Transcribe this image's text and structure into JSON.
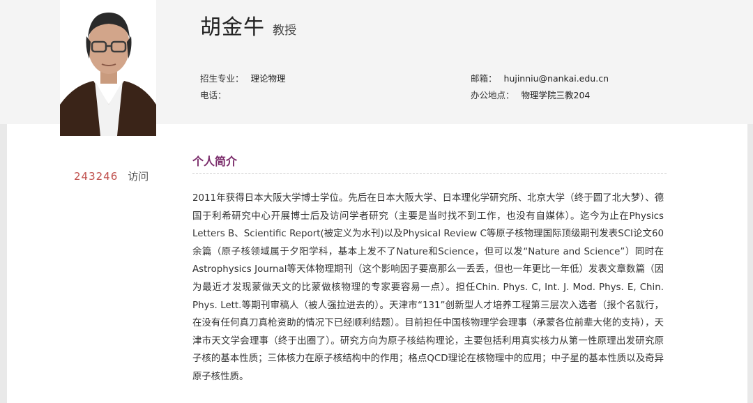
{
  "profile": {
    "name": "胡金牛",
    "title": "教授",
    "photo_alt": "person-portrait"
  },
  "info": {
    "major_label": "招生专业：",
    "major_value": "理论物理",
    "phone_label": "电话：",
    "phone_value": "",
    "email_label": "邮箱：",
    "email_value": "hujinniu@nankai.edu.cn",
    "office_label": "办公地点：",
    "office_value": "物理学院三教204"
  },
  "visits": {
    "count": "243246",
    "unit": "访问"
  },
  "section": {
    "heading": "个人简介"
  },
  "bio": "2011年获得日本大阪大学博士学位。先后在日本大阪大学、日本理化学研究所、北京大学（终于圆了北大梦）、德国于利希研究中心开展博士后及访问学者研究（主要是当时找不到工作，也没有自媒体）。迄今为止在Physics Letters B、Scientific Report(被定义为水刊)以及Physical Review C等原子核物理国际顶级期刊发表SCI论文60余篇（原子核领域属于夕阳学科，基本上发不了Nature和Science，但可以发“Nature and Science”）同时在Astrophysics Journal等天体物理期刊（这个影响因子要高那么一丢丢，但也一年更比一年低）发表文章数篇（因为最近才发现蒙做天文的比蒙做核物理的专家要容易一点）。担任Chin. Phys. C, Int. J. Mod. Phys. E, Chin. Phys. Lett.等期刊审稿人（被人强拉进去的）。天津市“131”创新型人才培养工程第三层次入选者（报个名就行，在没有任何真刀真枪资助的情况下已经顺利结题）。目前担任中国核物理学会理事（承蒙各位前辈大佬的支持），天津市天文学会理事（终于出圈了）。研究方向为原子核结构理论，主要包括利用真实核力从第一性原理出发研究原子核的基本性质；三体核力在原子核结构中的作用；格点QCD理论在核物理中的应用；中子星的基本性质以及奇异原子核性质。",
  "colors": {
    "visit_count": "#c0504d",
    "heading": "#7a2b6a",
    "header_bg": "#f4f4f4",
    "page_bg": "#e9e9e9"
  }
}
